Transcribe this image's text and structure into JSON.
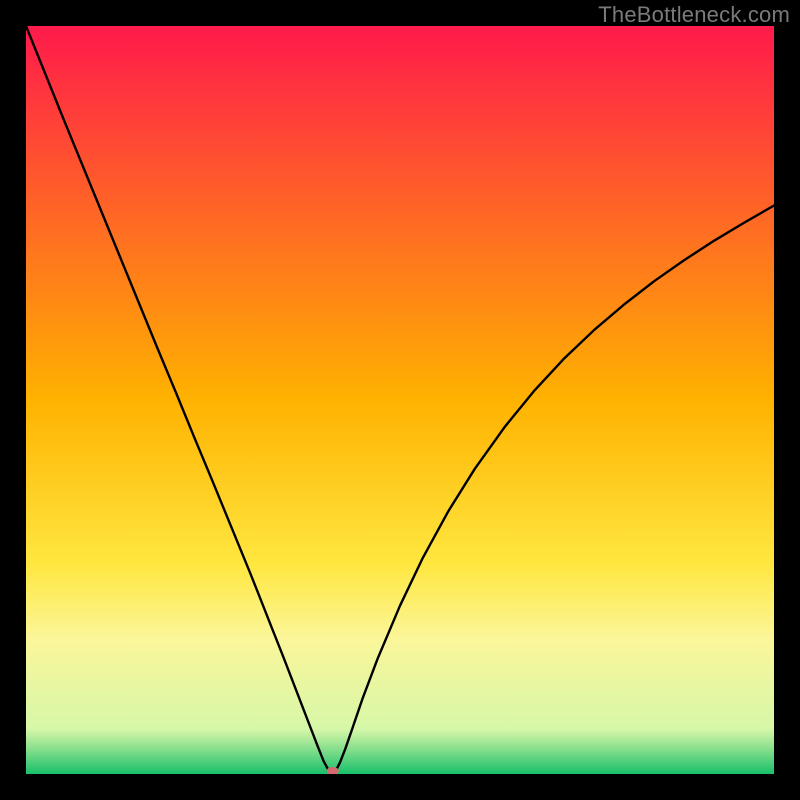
{
  "watermark": {
    "text": "TheBottleneck.com"
  },
  "chart_data": {
    "type": "line",
    "title": "",
    "xlabel": "",
    "ylabel": "",
    "xlim": [
      0,
      100
    ],
    "ylim": [
      0,
      100
    ],
    "grid": false,
    "legend": false,
    "background_gradient": {
      "stops": [
        {
          "offset": 0.0,
          "color": "#ff1a4b"
        },
        {
          "offset": 0.5,
          "color": "#ffb200"
        },
        {
          "offset": 0.72,
          "color": "#ffe740"
        },
        {
          "offset": 0.82,
          "color": "#fbf69a"
        },
        {
          "offset": 0.94,
          "color": "#d6f7a8"
        },
        {
          "offset": 0.965,
          "color": "#8ce08e"
        },
        {
          "offset": 1.0,
          "color": "#18c06a"
        }
      ]
    },
    "series": [
      {
        "name": "bottleneck-curve",
        "x": [
          0.0,
          2.5,
          5.0,
          7.5,
          10.0,
          12.5,
          15.0,
          17.5,
          20.0,
          22.5,
          25.0,
          27.5,
          30.0,
          31.5,
          33.0,
          34.5,
          36.0,
          37.0,
          38.0,
          39.0,
          39.8,
          40.4,
          41.0,
          41.5,
          42.0,
          42.7,
          43.6,
          45.0,
          47.0,
          50.0,
          53.0,
          56.5,
          60.0,
          64.0,
          68.0,
          72.0,
          76.0,
          80.0,
          84.0,
          88.0,
          92.0,
          96.0,
          100.0
        ],
        "values": [
          100.0,
          93.8,
          87.6,
          81.5,
          75.4,
          69.3,
          63.2,
          57.1,
          51.1,
          45.0,
          39.0,
          32.9,
          26.8,
          23.0,
          19.2,
          15.4,
          11.5,
          8.9,
          6.3,
          3.7,
          1.7,
          0.6,
          0.0,
          0.6,
          1.6,
          3.4,
          6.0,
          10.1,
          15.4,
          22.5,
          28.8,
          35.2,
          40.8,
          46.4,
          51.3,
          55.6,
          59.4,
          62.8,
          65.9,
          68.7,
          71.3,
          73.7,
          76.0
        ]
      }
    ],
    "marker": {
      "x": 41.0,
      "y": 0.0,
      "color": "#d46a6f",
      "rx": 6,
      "ry": 4
    }
  }
}
